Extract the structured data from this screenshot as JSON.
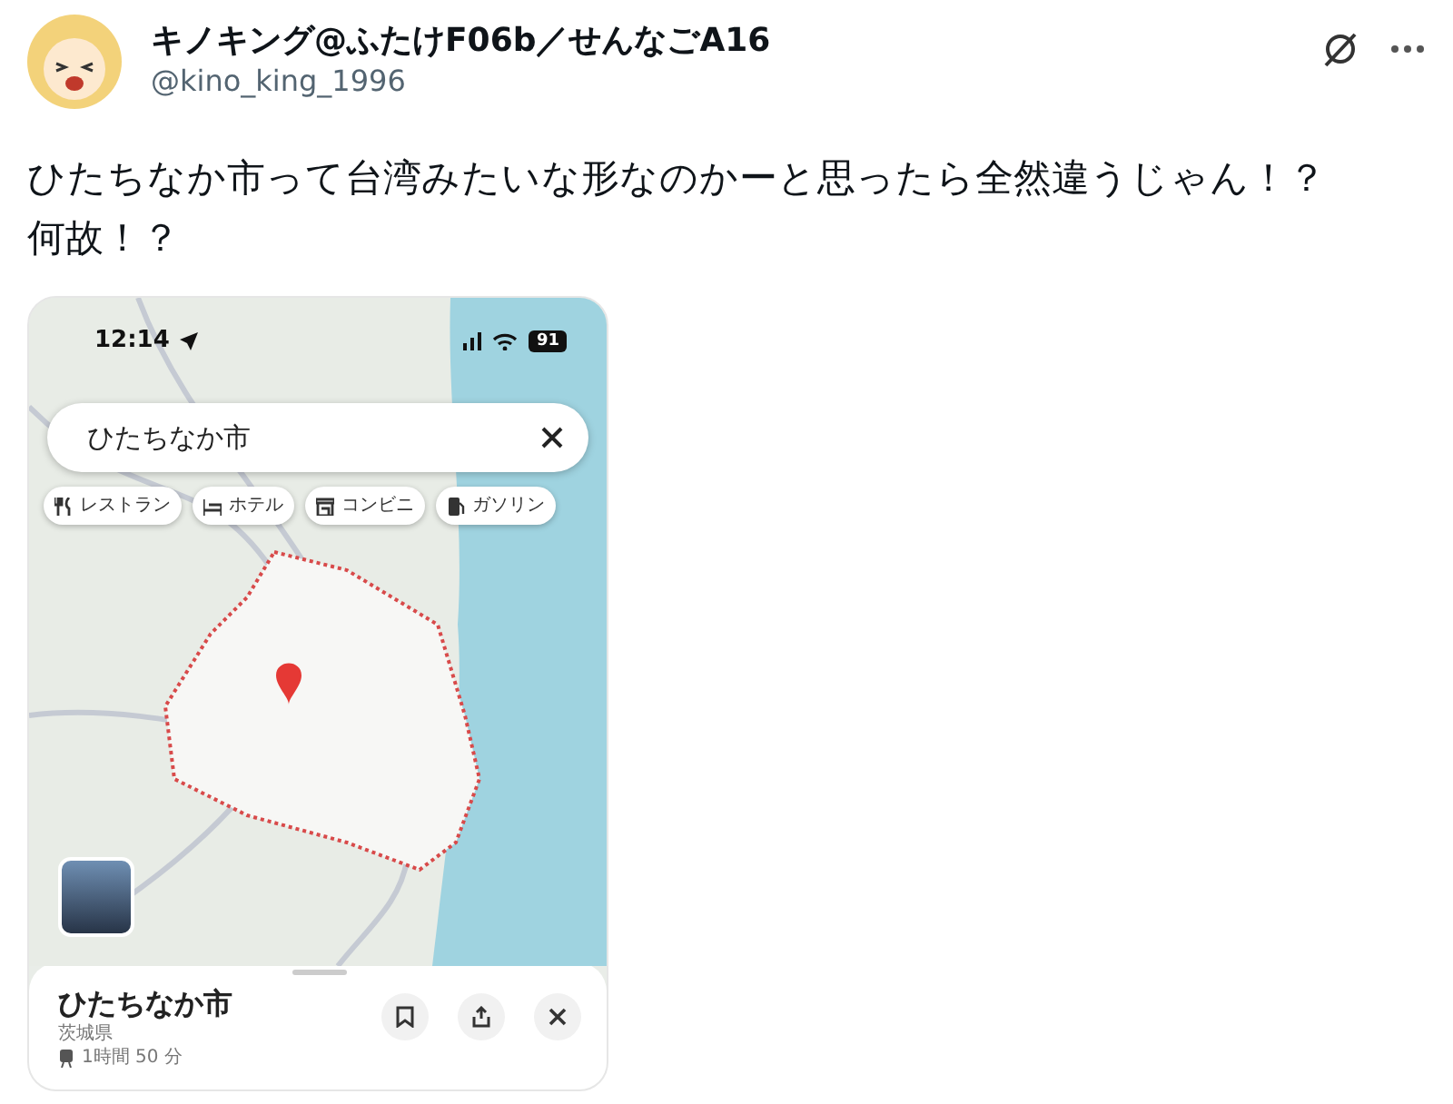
{
  "post": {
    "author": "キノキング@ふたけF06b／せんなごA16",
    "handle": "@kino_king_1996",
    "text": "ひたちなか市って台湾みたいな形なのかーと思ったら全然違うじゃん！？何故！？"
  },
  "phone_screenshot": {
    "status_bar": {
      "time": "12:14",
      "battery": "91"
    },
    "search": {
      "value": "ひたちなか市"
    },
    "chips": [
      {
        "kind": "restaurant",
        "label": "レストラン"
      },
      {
        "kind": "hotel",
        "label": "ホテル"
      },
      {
        "kind": "store",
        "label": "コンビニ"
      },
      {
        "kind": "gas",
        "label": "ガソリン"
      }
    ],
    "place": {
      "name": "ひたちなか市",
      "region": "茨城県",
      "travel_time": "1時間 50 分"
    }
  }
}
